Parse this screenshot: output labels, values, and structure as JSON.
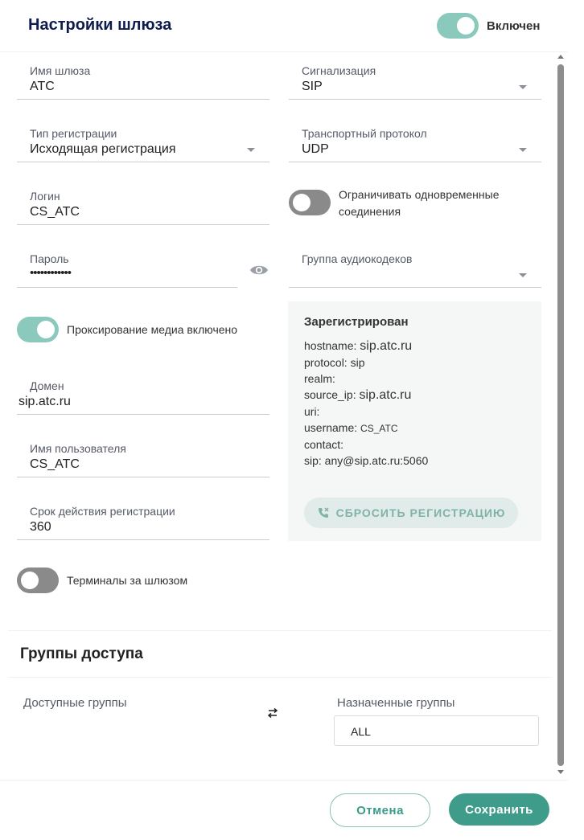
{
  "header": {
    "title": "Настройки шлюза",
    "enabled_label": "Включен",
    "enabled": true
  },
  "fields": {
    "gateway_name": {
      "label": "Имя шлюза",
      "value": "ATC"
    },
    "signaling": {
      "label": "Сигнализация",
      "value": "SIP"
    },
    "registration_type": {
      "label": "Тип регистрации",
      "value": "Исходящая регистрация"
    },
    "transport": {
      "label": "Транспортный протокол",
      "value": "UDP"
    },
    "login": {
      "label": "Логин",
      "value": "CS_ATC"
    },
    "password": {
      "label": "Пароль",
      "value": "••••••••••••"
    },
    "audio_codecs": {
      "label": "Группа аудиокодеков",
      "value": ""
    },
    "domain": {
      "label": "Домен",
      "value": "sip.atc.ru"
    },
    "username": {
      "label": "Имя пользователя",
      "value": "CS_ATC"
    },
    "expiry": {
      "label": "Срок действия регистрации",
      "value": "360"
    }
  },
  "toggles": {
    "limit_connections": {
      "label_line1": "Ограничивать одновременные",
      "label_line2": "соединения",
      "on": false
    },
    "media_proxy": {
      "label": "Проксирование медиа включено",
      "on": true
    },
    "terminals_behind": {
      "label": "Терминалы за шлюзом",
      "on": false
    }
  },
  "registration": {
    "status": "Зарегистрирован",
    "hostname_key": "hostname:",
    "hostname_value": "sip.atc.ru",
    "protocol": "protocol: sip",
    "realm": "realm:",
    "source_ip_key": "source_ip:",
    "source_ip_value": "sip.atc.ru",
    "uri": "uri:",
    "username_key": "username:",
    "username_value": "CS_ATC",
    "contact": "contact:",
    "sip": "sip: any@sip.atc.ru:5060",
    "reset_label": "СБРОСИТЬ РЕГИСТРАЦИЮ"
  },
  "access_groups": {
    "title": "Группы доступа",
    "available_label": "Доступные группы",
    "assigned_label": "Назначенные группы",
    "assigned": [
      "ALL"
    ]
  },
  "footer": {
    "cancel_label": "Отмена",
    "save_label": "Сохранить"
  },
  "colors": {
    "accent": "#3f9c8a",
    "toggle_on": "#8ac9bc",
    "toggle_off": "#8a8a8a",
    "title": "#0e1b4d"
  }
}
